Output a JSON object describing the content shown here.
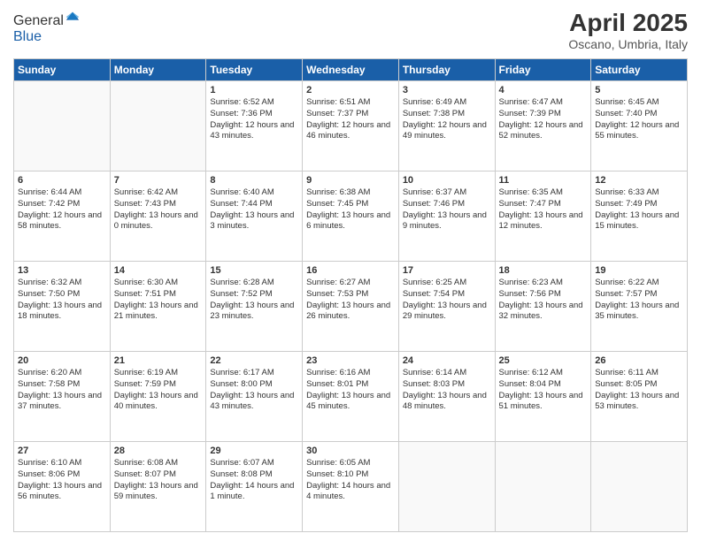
{
  "logo": {
    "general": "General",
    "blue": "Blue"
  },
  "title": "April 2025",
  "location": "Oscano, Umbria, Italy",
  "days_of_week": [
    "Sunday",
    "Monday",
    "Tuesday",
    "Wednesday",
    "Thursday",
    "Friday",
    "Saturday"
  ],
  "weeks": [
    [
      {
        "day": "",
        "info": ""
      },
      {
        "day": "",
        "info": ""
      },
      {
        "day": "1",
        "info": "Sunrise: 6:52 AM\nSunset: 7:36 PM\nDaylight: 12 hours and 43 minutes."
      },
      {
        "day": "2",
        "info": "Sunrise: 6:51 AM\nSunset: 7:37 PM\nDaylight: 12 hours and 46 minutes."
      },
      {
        "day": "3",
        "info": "Sunrise: 6:49 AM\nSunset: 7:38 PM\nDaylight: 12 hours and 49 minutes."
      },
      {
        "day": "4",
        "info": "Sunrise: 6:47 AM\nSunset: 7:39 PM\nDaylight: 12 hours and 52 minutes."
      },
      {
        "day": "5",
        "info": "Sunrise: 6:45 AM\nSunset: 7:40 PM\nDaylight: 12 hours and 55 minutes."
      }
    ],
    [
      {
        "day": "6",
        "info": "Sunrise: 6:44 AM\nSunset: 7:42 PM\nDaylight: 12 hours and 58 minutes."
      },
      {
        "day": "7",
        "info": "Sunrise: 6:42 AM\nSunset: 7:43 PM\nDaylight: 13 hours and 0 minutes."
      },
      {
        "day": "8",
        "info": "Sunrise: 6:40 AM\nSunset: 7:44 PM\nDaylight: 13 hours and 3 minutes."
      },
      {
        "day": "9",
        "info": "Sunrise: 6:38 AM\nSunset: 7:45 PM\nDaylight: 13 hours and 6 minutes."
      },
      {
        "day": "10",
        "info": "Sunrise: 6:37 AM\nSunset: 7:46 PM\nDaylight: 13 hours and 9 minutes."
      },
      {
        "day": "11",
        "info": "Sunrise: 6:35 AM\nSunset: 7:47 PM\nDaylight: 13 hours and 12 minutes."
      },
      {
        "day": "12",
        "info": "Sunrise: 6:33 AM\nSunset: 7:49 PM\nDaylight: 13 hours and 15 minutes."
      }
    ],
    [
      {
        "day": "13",
        "info": "Sunrise: 6:32 AM\nSunset: 7:50 PM\nDaylight: 13 hours and 18 minutes."
      },
      {
        "day": "14",
        "info": "Sunrise: 6:30 AM\nSunset: 7:51 PM\nDaylight: 13 hours and 21 minutes."
      },
      {
        "day": "15",
        "info": "Sunrise: 6:28 AM\nSunset: 7:52 PM\nDaylight: 13 hours and 23 minutes."
      },
      {
        "day": "16",
        "info": "Sunrise: 6:27 AM\nSunset: 7:53 PM\nDaylight: 13 hours and 26 minutes."
      },
      {
        "day": "17",
        "info": "Sunrise: 6:25 AM\nSunset: 7:54 PM\nDaylight: 13 hours and 29 minutes."
      },
      {
        "day": "18",
        "info": "Sunrise: 6:23 AM\nSunset: 7:56 PM\nDaylight: 13 hours and 32 minutes."
      },
      {
        "day": "19",
        "info": "Sunrise: 6:22 AM\nSunset: 7:57 PM\nDaylight: 13 hours and 35 minutes."
      }
    ],
    [
      {
        "day": "20",
        "info": "Sunrise: 6:20 AM\nSunset: 7:58 PM\nDaylight: 13 hours and 37 minutes."
      },
      {
        "day": "21",
        "info": "Sunrise: 6:19 AM\nSunset: 7:59 PM\nDaylight: 13 hours and 40 minutes."
      },
      {
        "day": "22",
        "info": "Sunrise: 6:17 AM\nSunset: 8:00 PM\nDaylight: 13 hours and 43 minutes."
      },
      {
        "day": "23",
        "info": "Sunrise: 6:16 AM\nSunset: 8:01 PM\nDaylight: 13 hours and 45 minutes."
      },
      {
        "day": "24",
        "info": "Sunrise: 6:14 AM\nSunset: 8:03 PM\nDaylight: 13 hours and 48 minutes."
      },
      {
        "day": "25",
        "info": "Sunrise: 6:12 AM\nSunset: 8:04 PM\nDaylight: 13 hours and 51 minutes."
      },
      {
        "day": "26",
        "info": "Sunrise: 6:11 AM\nSunset: 8:05 PM\nDaylight: 13 hours and 53 minutes."
      }
    ],
    [
      {
        "day": "27",
        "info": "Sunrise: 6:10 AM\nSunset: 8:06 PM\nDaylight: 13 hours and 56 minutes."
      },
      {
        "day": "28",
        "info": "Sunrise: 6:08 AM\nSunset: 8:07 PM\nDaylight: 13 hours and 59 minutes."
      },
      {
        "day": "29",
        "info": "Sunrise: 6:07 AM\nSunset: 8:08 PM\nDaylight: 14 hours and 1 minute."
      },
      {
        "day": "30",
        "info": "Sunrise: 6:05 AM\nSunset: 8:10 PM\nDaylight: 14 hours and 4 minutes."
      },
      {
        "day": "",
        "info": ""
      },
      {
        "day": "",
        "info": ""
      },
      {
        "day": "",
        "info": ""
      }
    ]
  ]
}
